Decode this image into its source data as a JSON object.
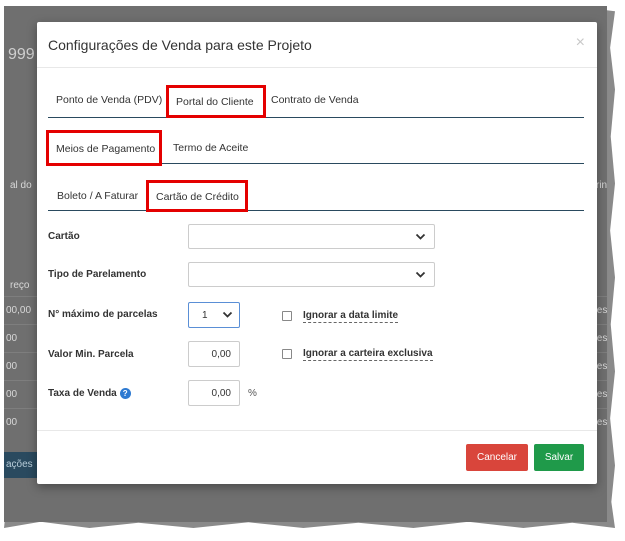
{
  "background": {
    "title_fragment": "999",
    "left_col_header": "al do",
    "right_col_header": "rin",
    "left_price_header": "reço",
    "row_left_values": [
      "00,00",
      "00",
      "00",
      "00",
      "00"
    ],
    "row_right_values": [
      "tes",
      "tes",
      "tes",
      "tes",
      "tes"
    ],
    "footer_fragment": "ações"
  },
  "modal": {
    "title": "Configurações de Venda para este Projeto",
    "close_symbol": "×"
  },
  "tabs_level1": {
    "items": [
      "Ponto de Venda (PDV)",
      "Portal do Cliente",
      "Contrato de Venda"
    ],
    "active": "Portal do Cliente"
  },
  "tabs_level2": {
    "items": [
      "Meios de Pagamento",
      "Termo de Aceite"
    ],
    "active": "Meios de Pagamento"
  },
  "tabs_level3": {
    "items": [
      "Boleto / A Faturar",
      "Cartão de Crédito"
    ],
    "active": "Cartão de Crédito"
  },
  "form": {
    "cartao_label": "Cartão",
    "cartao_value": "",
    "tipo_parcelamento_label": "Tipo de Parelamento",
    "tipo_parcelamento_value": "",
    "max_parcelas_label": "N° máximo de parcelas",
    "max_parcelas_value": "1",
    "ignorar_data_label": "Ignorar a data limite",
    "ignorar_data_checked": false,
    "valor_min_label": "Valor Min. Parcela",
    "valor_min_value": "0,00",
    "ignorar_carteira_label": "Ignorar a carteira exclusiva",
    "ignorar_carteira_checked": false,
    "taxa_label": "Taxa de Venda",
    "taxa_value": "0,00",
    "taxa_suffix": "%",
    "help_symbol": "?"
  },
  "footer": {
    "cancel_label": "Cancelar",
    "save_label": "Salvar"
  },
  "colors": {
    "highlight": "#e40000",
    "cancel": "#d9453b",
    "save": "#1f9a4a",
    "tab_line": "#2a4a5f",
    "help_icon": "#2e7ad1"
  },
  "icons": {
    "select_arrow": "chevron-down-icon",
    "help": "question-circle-icon",
    "close": "close-icon"
  }
}
